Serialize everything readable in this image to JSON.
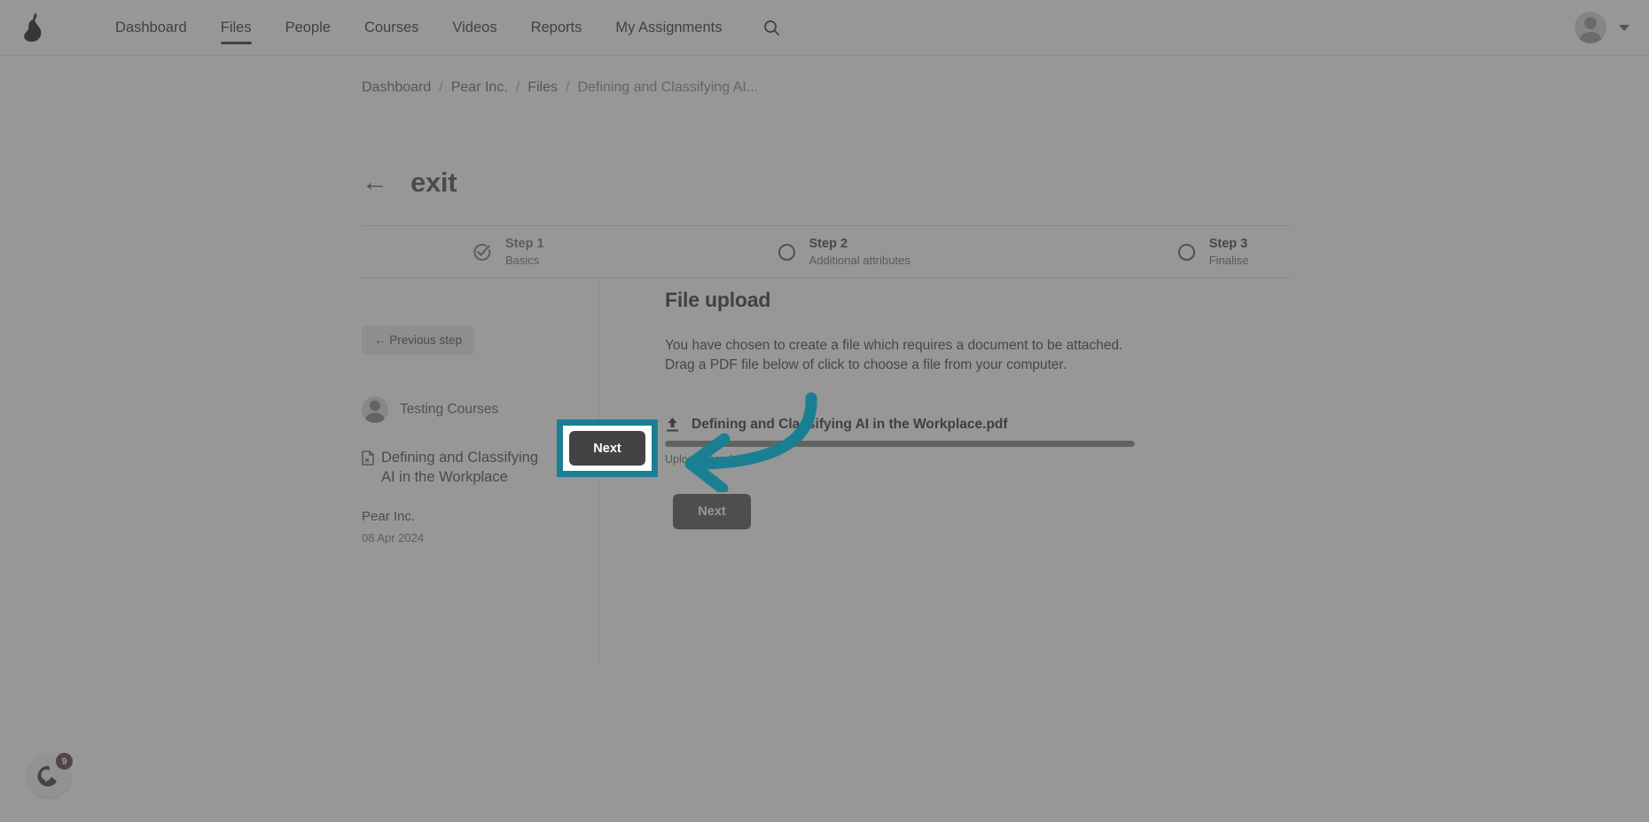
{
  "nav": {
    "logo_icon": "pear-logo",
    "items": [
      {
        "label": "Dashboard",
        "active": false
      },
      {
        "label": "Files",
        "active": true
      },
      {
        "label": "People",
        "active": false
      },
      {
        "label": "Courses",
        "active": false
      },
      {
        "label": "Videos",
        "active": false
      },
      {
        "label": "Reports",
        "active": false
      },
      {
        "label": "My Assignments",
        "active": false
      }
    ],
    "search_icon": "search-icon",
    "avatar_icon": "user-avatar-icon",
    "chevron_icon": "chevron-down-icon"
  },
  "breadcrumb": {
    "items": [
      "Dashboard",
      "Pear Inc.",
      "Files"
    ],
    "current": "Defining and Classifying AI...",
    "separator": "/"
  },
  "exit": {
    "arrow": "←",
    "label": "exit"
  },
  "stepper": {
    "steps": [
      {
        "title": "Step 1",
        "sub": "Basics",
        "state": "done"
      },
      {
        "title": "Step 2",
        "sub": "Additional attributes",
        "state": "todo"
      },
      {
        "title": "Step 3",
        "sub": "Finalise",
        "state": "todo"
      }
    ]
  },
  "sidebar": {
    "previous_step_label": "← Previous step",
    "owner_name": "Testing Courses",
    "doc_title": "Defining and Classifying AI in the Workplace",
    "org_name": "Pear Inc.",
    "doc_date": "08 Apr 2024"
  },
  "panel": {
    "title": "File upload",
    "description": "You have chosen to create a file which requires a document to be attached. Drag a PDF file below of click to choose a file from your computer.",
    "upload": {
      "file_name": "Defining and Classifying AI in the Workplace.pdf",
      "progress_percent": 100,
      "status_label": "Upload complete",
      "progress_color": "#4a8d3c"
    },
    "next_label": "Next"
  },
  "help": {
    "badge_count": "9",
    "icon": "help-widget-icon"
  },
  "annotation": {
    "highlight_color": "#1b7f93",
    "arrow_color": "#1b7f93",
    "target_label": "Next"
  }
}
